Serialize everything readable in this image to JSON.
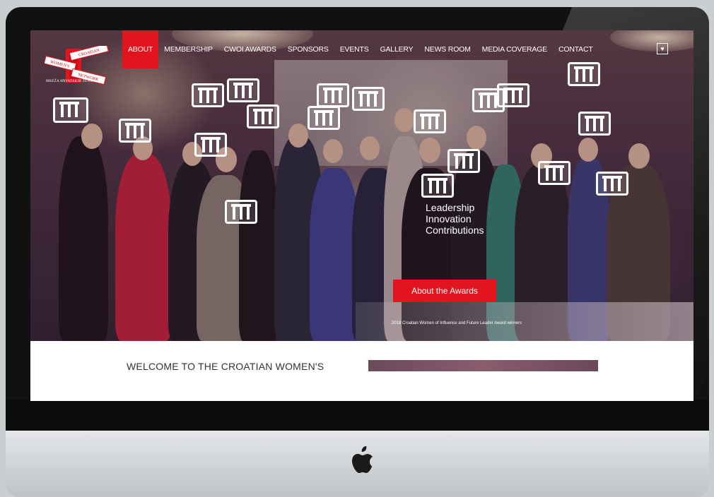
{
  "nav": {
    "items": [
      {
        "label": "ABOUT",
        "active": true
      },
      {
        "label": "MEMBERSHIP"
      },
      {
        "label": "CWOI AWARDS"
      },
      {
        "label": "SPONSORS"
      },
      {
        "label": "EVENTS"
      },
      {
        "label": "GALLERY"
      },
      {
        "label": "NEWS ROOM"
      },
      {
        "label": "MEDIA COVERAGE"
      },
      {
        "label": "CONTACT"
      }
    ]
  },
  "logo": {
    "line1": "CROATIAN",
    "line2": "WOMEN'S",
    "line3": "NETWORK",
    "subtitle": "MREŽA HRVATSKIH ŽENA"
  },
  "social": {
    "icon": "twitter-icon",
    "glyph": "♥"
  },
  "hero": {
    "tagline": [
      "Leadership",
      "Innovation",
      "Contributions"
    ],
    "button_label": "About the Awards",
    "caption": "2018 Croatian Women of Influence and Future Leader Award winners"
  },
  "welcome": {
    "heading": "WELCOME TO THE CROATIAN WOMEN'S"
  },
  "colors": {
    "accent": "#e3141d"
  }
}
